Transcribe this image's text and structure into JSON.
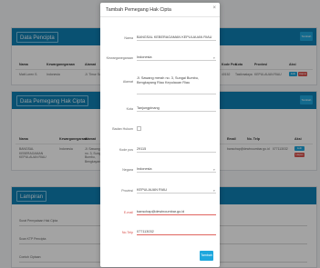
{
  "colors": {
    "header": "#0f7fb3",
    "accent": "#1ea7dd",
    "danger": "#d9534f",
    "overlay": "rgba(0,0,0,0.36)"
  },
  "background": {
    "pencipta": {
      "title": "Data Pencipta",
      "add_label": "Tambah",
      "headers": [
        "Nama",
        "Kewarganegaraan",
        "Alamat",
        "Kode Pos",
        "Kota",
        "Provinsi",
        "Aksi"
      ],
      "row": [
        "Matt Loren S.",
        "Indonesia",
        "Jl. Timur Sari Raya 2 RT 001 RW 003",
        "40152",
        "Tasikmalaya",
        "KEPULAUAN RIAU"
      ],
      "edit_label": "Edit",
      "delete_label": "Hapus"
    },
    "pemegang": {
      "title": "Data Pemegang Hak Cipta",
      "add_label": "Tambah",
      "headers": [
        "Nama",
        "Kewarganegaraan",
        "Alamat",
        "Email",
        "No. Telp",
        "Aksi"
      ],
      "row": [
        "BANGSAL KEBERAGAMAN KEPULAUAN RIAU",
        "Indonesia",
        "Jl. Sawang merah no. 3, Sungai Bumbu, Bengkayang Riau",
        "banschap@dewinoumbar.go.id",
        "077113032"
      ],
      "edit_label": "Edit",
      "delete_label": "Hapus"
    },
    "lampiran": {
      "title": "Lampiran",
      "items": [
        "Surat Pernyataan Hak Cipta",
        "Scan KTP Pencipta",
        "Contoh Ciptaan"
      ]
    }
  },
  "modal": {
    "title": "Tambah Pemegang Hak Cipta",
    "close_icon": "×",
    "fields": {
      "nama": {
        "label": "Nama",
        "value": "BANGSAL KEBERAGAMAN KEPULAUAN RIAU"
      },
      "kewarganegaraan": {
        "label": "Kewarganegaraan",
        "value": "Indonesia"
      },
      "alamat": {
        "label": "Alamat",
        "value": "Jl. Sawang merah no. 3, Sungai Bumbu, Bengkayang Riau Kepulauan Riau"
      },
      "kota": {
        "label": "Kota",
        "value": "Tanjungpinang"
      },
      "badan_hukum": {
        "label": "Badan Hukum"
      },
      "kode_pos": {
        "label": "Kode pos",
        "value": "29115"
      },
      "negara": {
        "label": "Negara",
        "value": "Indonesia"
      },
      "provinsi": {
        "label": "Provinsi",
        "value": "KEPULAUAN RIAU"
      },
      "email": {
        "label": "E-mail",
        "value": "banschap@dewinoumbar.go.id"
      },
      "telp": {
        "label": "No.Telp",
        "value": "077113032"
      }
    },
    "submit_label": "Tambah"
  }
}
